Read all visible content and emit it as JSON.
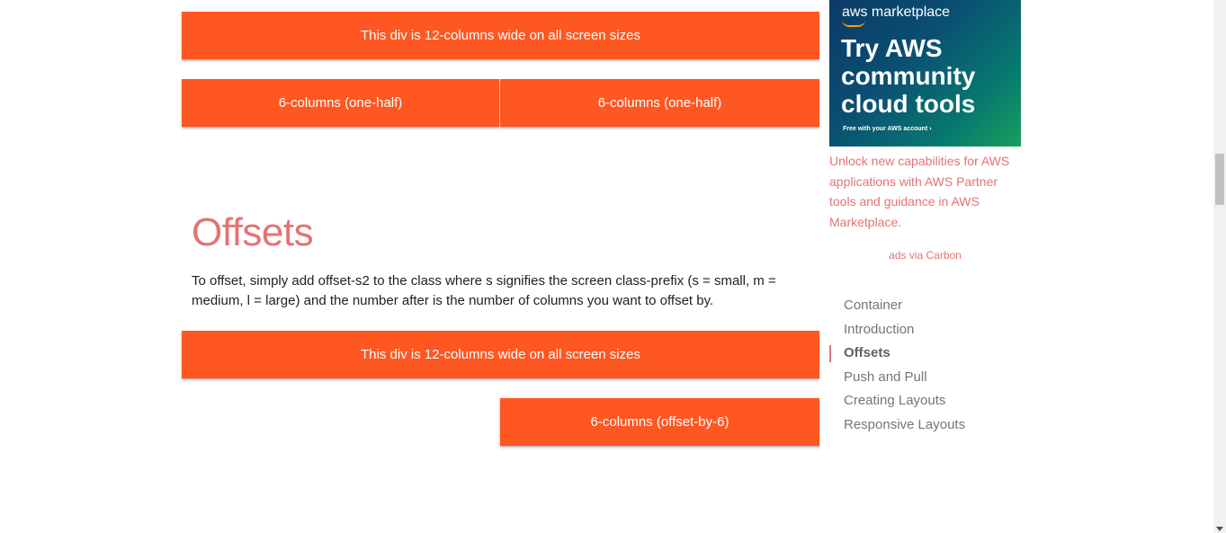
{
  "grid_examples": {
    "full_row": "This div is 12-columns wide on all screen sizes",
    "half_left": "6-columns (one-half)",
    "half_right": "6-columns (one-half)"
  },
  "offsets_section": {
    "title": "Offsets",
    "description": "To offset, simply add offset-s2 to the class where s signifies the screen class-prefix (s = small, m = medium, l = large) and the number after is the number of columns you want to offset by.",
    "full_row": "This div is 12-columns wide on all screen sizes",
    "offset_box": "6-columns (offset-by-6)"
  },
  "ad": {
    "brand": "aws marketplace",
    "headline": "Try AWS community cloud tools",
    "small_print": "Free with your AWS account ›",
    "text": "Unlock new capabilities for AWS applications with AWS Partner tools and guidance in AWS Marketplace.",
    "via": "ads via Carbon"
  },
  "toc": {
    "items": [
      {
        "label": "Container"
      },
      {
        "label": "Introduction"
      },
      {
        "label": "Offsets"
      },
      {
        "label": "Push and Pull"
      },
      {
        "label": "Creating Layouts"
      },
      {
        "label": "Responsive Layouts"
      }
    ],
    "active_item": "Offsets"
  },
  "colors": {
    "accent": "#ff5722",
    "title": "#e57373",
    "link": "#e57373"
  }
}
